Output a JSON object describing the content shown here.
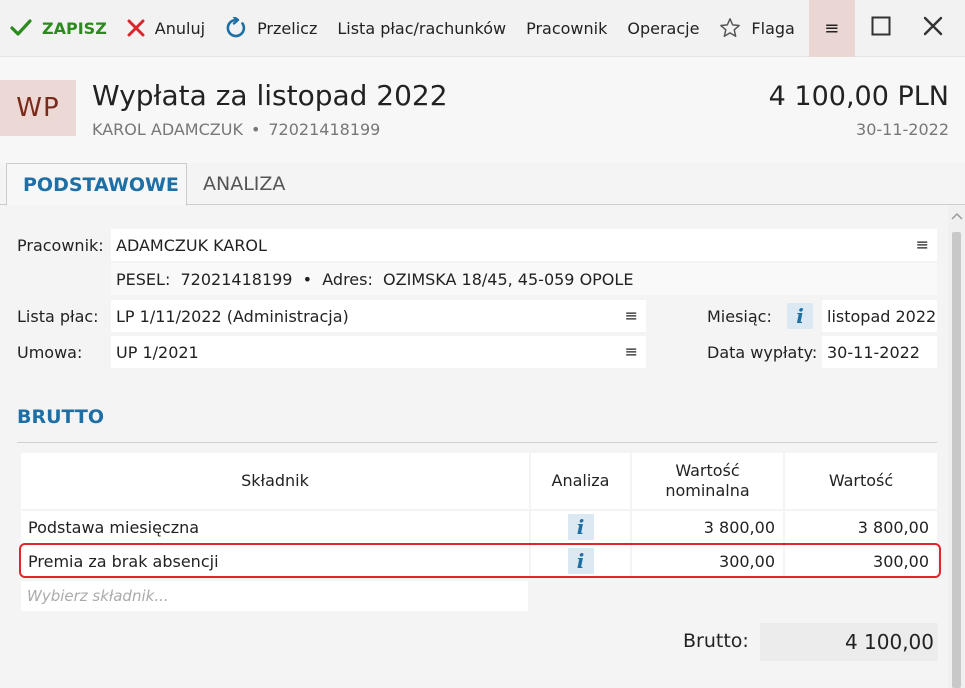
{
  "toolbar": {
    "save_label": "ZAPISZ",
    "cancel_label": "Anuluj",
    "recalc_label": "Przelicz",
    "lists_label": "Lista płac/rachunków",
    "employee_label": "Pracownik",
    "operations_label": "Operacje",
    "flag_label": "Flaga",
    "menu_glyph": "≡"
  },
  "header": {
    "avatar": "WP",
    "title": "Wypłata za listopad 2022",
    "employee_name": "KAROL ADAMCZUK",
    "separator": "•",
    "employee_pesel": "72021418199",
    "amount": "4 100,00 PLN",
    "date": "30-11-2022"
  },
  "tabs": [
    {
      "label": "PODSTAWOWE",
      "active": true
    },
    {
      "label": "ANALIZA",
      "active": false
    }
  ],
  "form": {
    "employee_label": "Pracownik:",
    "employee_value": "ADAMCZUK KAROL",
    "employee_details": "PESEL:  72021418199  •  Adres:  OZIMSKA 18/45, 45-059 OPOLE",
    "payroll_label": "Lista płac:",
    "payroll_value": "LP 1/11/2022 (Administracja)",
    "contract_label": "Umowa:",
    "contract_value": "UP 1/2021",
    "month_label": "Miesiąc:",
    "month_value": "listopad 2022",
    "paydate_label": "Data wypłaty:",
    "paydate_value": "30-11-2022",
    "menu_glyph": "≡",
    "info_glyph": "i"
  },
  "brutto": {
    "section_title": "BRUTTO",
    "columns": [
      "Składnik",
      "Analiza",
      "Wartość nominalna",
      "Wartość"
    ],
    "rows": [
      {
        "name": "Podstawa miesięczna",
        "nominal": "3 800,00",
        "value": "3 800,00"
      },
      {
        "name": "Premia za brak absencji",
        "nominal": "300,00",
        "value": "300,00"
      }
    ],
    "placeholder": "Wybierz składnik...",
    "total_label": "Brutto:",
    "total_value": "4 100,00"
  },
  "colors": {
    "accent": "#1d6fa5",
    "save": "#2d8a1f",
    "cancel": "#d9262b",
    "highlight": "#e0262b"
  }
}
